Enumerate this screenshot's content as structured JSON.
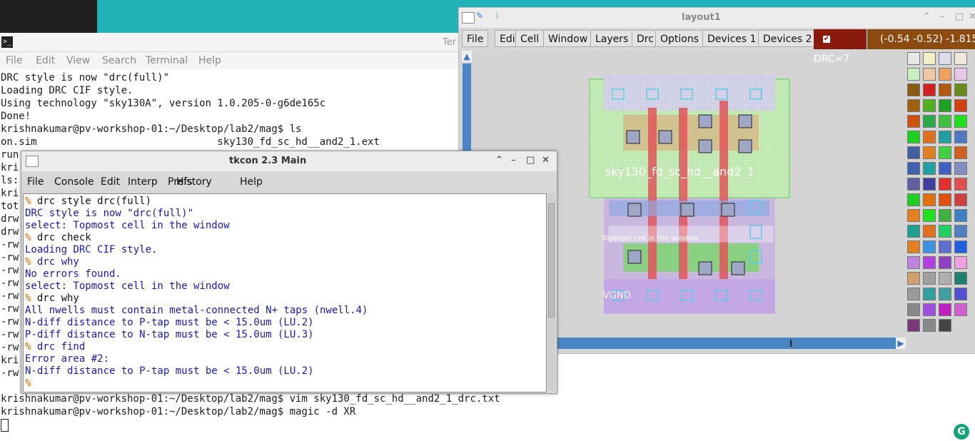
{
  "terminal": {
    "title": "Ter",
    "menu": [
      "File",
      "Edit",
      "View",
      "Search",
      "Terminal",
      "Help"
    ],
    "lines": [
      "DRC style is now \"drc(full)\"",
      "Loading DRC CIF style.",
      "Using technology \"sky130A\", version 1.0.205-0-g6de165c",
      "Done!",
      "krishnakumar@pv-workshop-01:~/Desktop/lab2/mag$ ls",
      "on.sim                              sky130_fd_sc_hd__and2_1.ext",
      "run",
      "kri",
      "ls:",
      "kri",
      "tot",
      "drw",
      "drw",
      "-rw",
      "-rw",
      "-rw",
      "-rw",
      "-rw",
      "-rw",
      "-rw",
      "-rw",
      "-rw",
      "kri",
      "-rw"
    ],
    "bottom_lines": [
      "krishnakumar@pv-workshop-01:~/Desktop/lab2/mag$ vim sky130_fd_sc_hd__and2_1_drc.txt",
      "krishnakumar@pv-workshop-01:~/Desktop/lab2/mag$ magic -d XR"
    ]
  },
  "layout": {
    "title": "layout1",
    "menu": [
      "File",
      "Edit",
      "Cell",
      "Window",
      "Layers",
      "Drc",
      "Options",
      "Devices 1",
      "Devices 2"
    ],
    "drc_label": "DRC=7",
    "coords": "(-0.54 -0.52) -1.815 ·",
    "canvas_labels": {
      "cell": "sky130_fd_sc_hd__and2_1",
      "select": "Topmost cell in the window",
      "vgnd": "VGND"
    },
    "colors": {
      "drc_bg": "#8b1a0e",
      "coord_bg": "#8a4a10",
      "scroll": "#4a86c6"
    }
  },
  "tkcon": {
    "title": "tkcon 2.3 Main",
    "menu": [
      "File",
      "Console",
      "Edit",
      "Interp",
      "Prefs",
      "History",
      "Help"
    ],
    "lines": [
      {
        "p": "% ",
        "t": "drc style drc(full)",
        "c": "cmd"
      },
      {
        "p": "",
        "t": "DRC style is now \"drc(full)\"",
        "c": "out"
      },
      {
        "p": "",
        "t": "select: Topmost cell in the window",
        "c": "out"
      },
      {
        "p": "% ",
        "t": "drc check",
        "c": "cmd"
      },
      {
        "p": "",
        "t": "Loading DRC CIF style.",
        "c": "out"
      },
      {
        "p": "% ",
        "t": "drc why",
        "c": "out"
      },
      {
        "p": "",
        "t": "No errors found.",
        "c": "out"
      },
      {
        "p": "",
        "t": "select: Topmost cell in the window",
        "c": "out"
      },
      {
        "p": "% ",
        "t": "drc why",
        "c": "cmd"
      },
      {
        "p": "",
        "t": "All nwells must contain metal-connected N+ taps (nwell.4)",
        "c": "out"
      },
      {
        "p": "",
        "t": "N-diff distance to P-tap must be < 15.0um (LU.2)",
        "c": "out"
      },
      {
        "p": "",
        "t": "P-diff distance to N-tap must be < 15.0um (LU.3)",
        "c": "out"
      },
      {
        "p": "% ",
        "t": "drc find",
        "c": "out"
      },
      {
        "p": "",
        "t": "Error area #2:",
        "c": "out"
      },
      {
        "p": "",
        "t": "N-diff distance to P-tap must be < 15.0um (LU.2)",
        "c": "out"
      },
      {
        "p": "%",
        "t": "",
        "c": "out"
      }
    ]
  },
  "icons": {
    "terminal_icon": ">_",
    "grammarly": "G"
  }
}
